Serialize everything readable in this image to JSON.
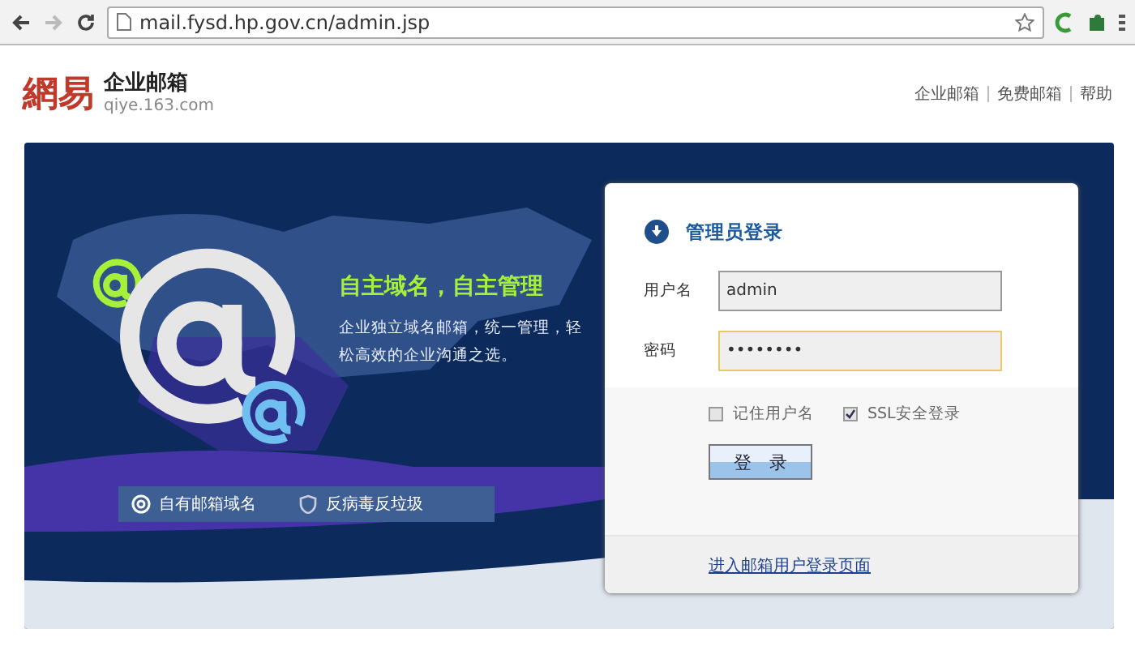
{
  "browser": {
    "url": "mail.fysd.hp.gov.cn/admin.jsp",
    "back_disabled": false,
    "forward_disabled": true
  },
  "header": {
    "logo": "網易",
    "product": "企业邮箱",
    "domain": "qiye.163.com",
    "links": [
      "企业邮箱",
      "免费邮箱",
      "帮助"
    ]
  },
  "banner": {
    "headline": "自主域名，自主管理",
    "description": "企业独立域名邮箱，统一管理，轻松高效的企业沟通之选。",
    "features": [
      {
        "kind": "at",
        "label": "自有邮箱域名"
      },
      {
        "kind": "shield",
        "label": "反病毒反垃圾"
      }
    ]
  },
  "login": {
    "title": "管理员登录",
    "fields": [
      {
        "label": "用户名",
        "value": "admin",
        "focused": false
      },
      {
        "label": "密码",
        "value": "••••••••",
        "focused": true
      }
    ],
    "options": [
      {
        "label": "记住用户名",
        "checked": false
      },
      {
        "label": "SSL安全登录",
        "checked": true
      }
    ],
    "submit": "登　录",
    "footer_link": "进入邮箱用户登录页面"
  }
}
